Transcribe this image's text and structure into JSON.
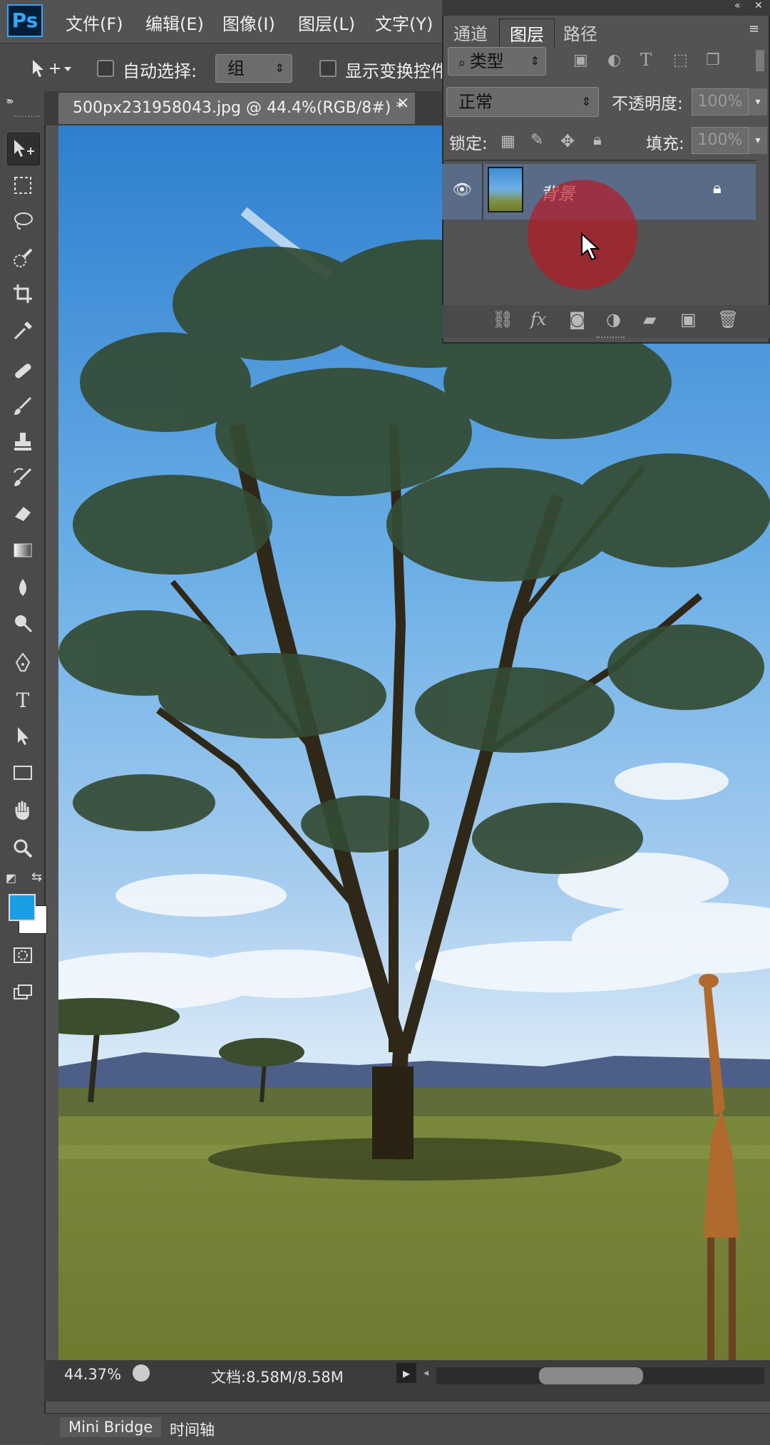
{
  "app": {
    "logo": "Ps"
  },
  "menu": [
    "文件(F)",
    "编辑(E)",
    "图像(I)",
    "图层(L)",
    "文字(Y)"
  ],
  "options_bar": {
    "auto_select_label": "自动选择:",
    "auto_select_value": "组",
    "show_transform_label": "显示变换控件"
  },
  "document": {
    "tab_title": "500px231958043.jpg @ 44.4%(RGB/8#) *",
    "close": "×"
  },
  "status": {
    "zoom": "44.37%",
    "doc_info": "文档:8.58M/8.58M"
  },
  "bottom_tabs": [
    "Mini Bridge",
    "时间轴"
  ],
  "layers_panel": {
    "tabs": [
      "通道",
      "图层",
      "路径"
    ],
    "active_tab": "图层",
    "kind_filter": "类型",
    "blend_mode": "正常",
    "opacity_label": "不透明度:",
    "opacity_value": "100%",
    "lock_label": "锁定:",
    "fill_label": "填充:",
    "fill_value": "100%",
    "layers": [
      {
        "name": "背景",
        "locked": true,
        "visible": true
      }
    ]
  },
  "colors": {
    "foreground": "#1a9ee6",
    "background": "#ffffff",
    "selected_layer": "#596b86",
    "cursor_highlight": "#be141e"
  },
  "icons": [
    "move-icon",
    "marquee-icon",
    "lasso-icon",
    "quick-select-icon",
    "crop-icon",
    "eyedropper-icon",
    "healing-icon",
    "brush-icon",
    "stamp-icon",
    "history-brush-icon",
    "eraser-icon",
    "gradient-icon",
    "blur-icon",
    "dodge-icon",
    "pen-icon",
    "type-icon",
    "path-select-icon",
    "shape-icon",
    "hand-icon",
    "zoom-icon",
    "quick-mask-icon",
    "screen-mode-icon"
  ]
}
